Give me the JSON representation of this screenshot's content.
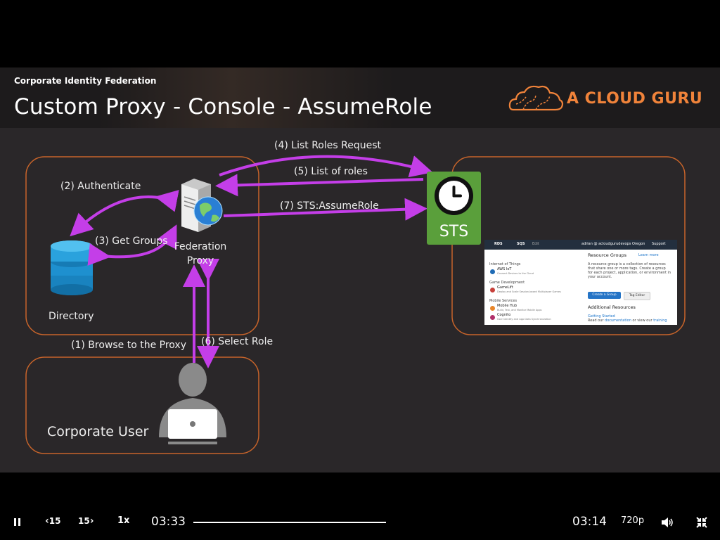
{
  "slide": {
    "subtitle": "Corporate Identity Federation",
    "title": "Custom Proxy - Console - AssumeRole",
    "logo_text": "A CLOUD GURU"
  },
  "diagram": {
    "labels": {
      "step1": "(1) Browse to the Proxy",
      "step2": "(2) Authenticate",
      "step3": "(3) Get Groups",
      "step4": "(4) List Roles Request",
      "step5": "(5) List of roles",
      "step6": "(6) Select Role",
      "step7": "(7) STS:AssumeRole"
    },
    "federation_proxy": [
      "Federation",
      "Proxy"
    ],
    "directory": "Directory",
    "corporate_user": "Corporate User",
    "sts": "STS"
  },
  "console": {
    "nav": [
      "RDS",
      "SQS",
      "Edit",
      "adrian @ acloudgurudevops",
      "Oregon",
      "Support"
    ],
    "sections": [
      {
        "header": "Internet of Things",
        "items": [
          {
            "name": "AWS IoT",
            "desc": "Connect Devices to the Cloud"
          }
        ]
      },
      {
        "header": "Game Development",
        "items": [
          {
            "name": "GameLift",
            "desc": "Deploy and Scale Session-based Multiplayer Games"
          }
        ]
      },
      {
        "header": "Mobile Services",
        "items": [
          {
            "name": "Mobile Hub",
            "desc": "Build, Test, and Monitor Mobile Apps"
          },
          {
            "name": "Cognito",
            "desc": "User Identity and App Data Synchronization"
          }
        ]
      }
    ],
    "resource_groups": {
      "title": "Resource Groups",
      "learn_more": "Learn more",
      "description": [
        "A resource group is a collection of resources",
        "that share one or more tags. Create a group",
        "for each project, application, or environment in",
        "your account."
      ],
      "create_button": "Create a Group",
      "tag_editor_button": "Tag Editor"
    },
    "additional_resources": {
      "title": "Additional Resources",
      "getting_started": "Getting Started",
      "read_our": "Read our",
      "documentation": "documentation",
      "or_view": "or view our",
      "training": "training"
    }
  },
  "player": {
    "play_pause_icon": "pause-icon",
    "back_label": "15",
    "forward_label": "15",
    "speed": "1x",
    "elapsed": "03:33",
    "remaining": "03:14",
    "quality": "720p",
    "volume_icon": "volume-icon",
    "fullscreen_icon": "exit-fullscreen-icon"
  },
  "colors": {
    "accent_orange": "#f0833a",
    "arrow_purple": "#c43ee8",
    "sts_green": "#5a9f3b",
    "box_border": "#c8642a"
  }
}
